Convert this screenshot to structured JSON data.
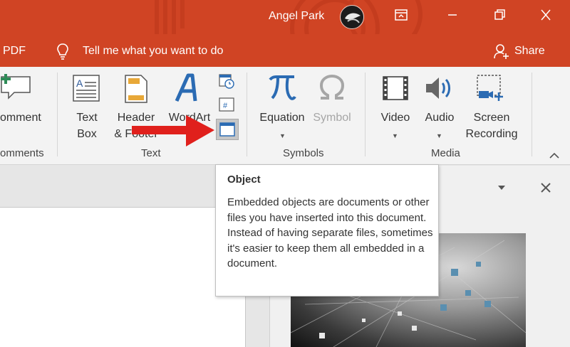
{
  "titlebar": {
    "user_name": "Angel Park",
    "colors": {
      "accent": "#d04424"
    }
  },
  "window_controls": {
    "ribbon_display_icon": "ribbon-display-options-icon",
    "minimize_icon": "minimize-icon",
    "restore_icon": "restore-icon",
    "close_icon": "close-icon"
  },
  "tellbar": {
    "left_tab_partial": "PDF",
    "tell_me": "Tell me what you want to do",
    "share": "Share"
  },
  "ribbon": {
    "comment_partial": "omment",
    "comments_group_partial": "omments",
    "text_group": {
      "label": "Text",
      "text_box_line1": "Text",
      "text_box_line2": "Box",
      "header_line1": "Header",
      "header_line2": "& Footer",
      "wordart_line1": "WordArt"
    },
    "symbols_group": {
      "label": "Symbols",
      "equation": "Equation",
      "symbol": "Symbol"
    },
    "media_group": {
      "label": "Media",
      "video": "Video",
      "audio": "Audio",
      "screen_line1": "Screen",
      "screen_line2": "Recording"
    },
    "collapse_icon": "chevron-up-icon"
  },
  "tooltip": {
    "title": "Object",
    "body": "Embedded objects are documents or other files you have inserted into this document. Instead of having separate files, sometimes it's easier to keep them all embedded in a document."
  },
  "panel": {
    "dropdown_icon": "dropdown-icon",
    "close_icon": "close-icon"
  }
}
